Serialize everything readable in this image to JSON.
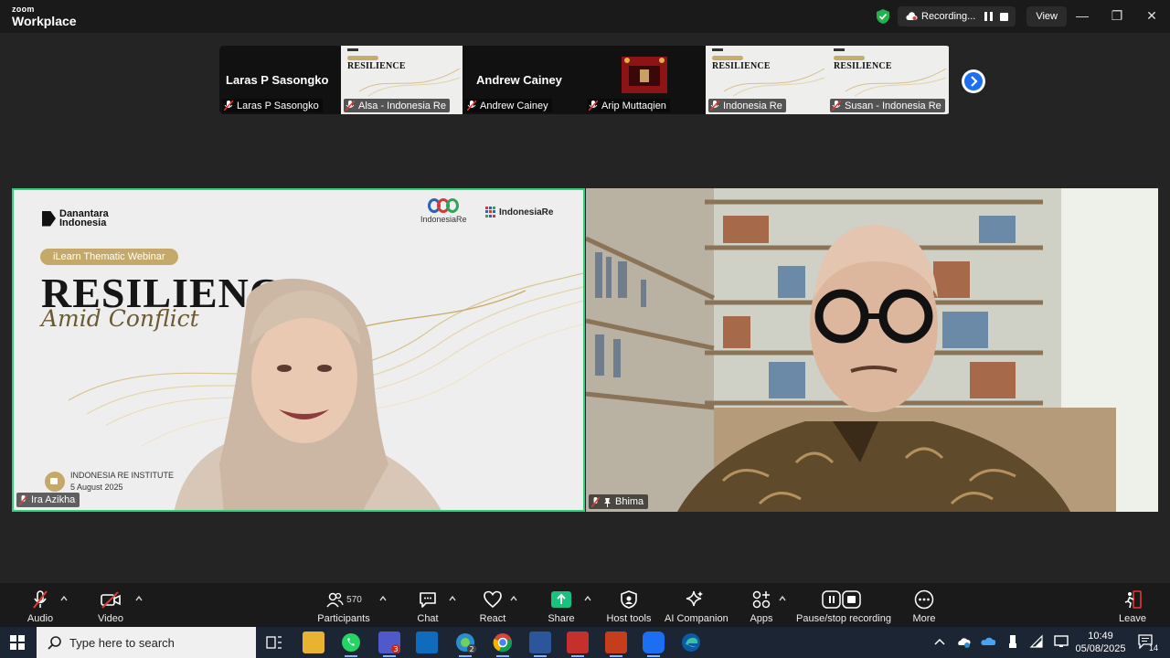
{
  "window": {
    "logo_top": "zoom",
    "logo_bottom": "Workplace",
    "recording_label": "Recording...",
    "view_label": "View",
    "minimize": "—",
    "maximize": "❐",
    "close": "✕"
  },
  "filmstrip": {
    "tiles": [
      {
        "type": "dark",
        "big_name": "Laras P Sasongko",
        "name": "Laras P Sasongko"
      },
      {
        "type": "slide",
        "slide_title": "RESILIENCE",
        "name": "Alsa - Indonesia Re"
      },
      {
        "type": "dark",
        "big_name": "Andrew Cainey",
        "name": "Andrew Cainey"
      },
      {
        "type": "video",
        "name": "Arip Muttaqien"
      },
      {
        "type": "slide",
        "slide_title": "RESILIENCE",
        "name": "Indonesia Re"
      },
      {
        "type": "slide",
        "slide_title": "RESILIENCE",
        "name": "Susan - Indonesia Re"
      }
    ]
  },
  "main_left": {
    "brand_line1": "Danantara",
    "brand_line2": "Indonesia",
    "partner1": "IndonesiaRe",
    "partner2": "IndonesiaRe",
    "tag": "iLearn Thematic Webinar",
    "title": "RESILIENCE",
    "subtitle": "Amid Conflict",
    "event_org": "INDONESIA RE INSTITUTE",
    "event_date": "5 August 2025",
    "participant_name": "Ira Azikha"
  },
  "main_right": {
    "participant_name": "Bhima"
  },
  "toolbar": {
    "audio": "Audio",
    "video": "Video",
    "participants": "Participants",
    "participants_count": "570",
    "chat": "Chat",
    "react": "React",
    "share": "Share",
    "host_tools": "Host tools",
    "ai_companion": "AI Companion",
    "apps": "Apps",
    "pause_stop": "Pause/stop recording",
    "more": "More",
    "leave": "Leave"
  },
  "taskbar": {
    "search_placeholder": "Type here to search",
    "time": "10:49",
    "date": "05/08/2025",
    "notification_count": "14",
    "teams_badge": "3",
    "edge_badge": "2"
  },
  "colors": {
    "active_speaker_border": "#2ed27a",
    "share_green": "#19c37d",
    "zoom_blue": "#1c6ef2",
    "gold": "#c4a96a"
  }
}
